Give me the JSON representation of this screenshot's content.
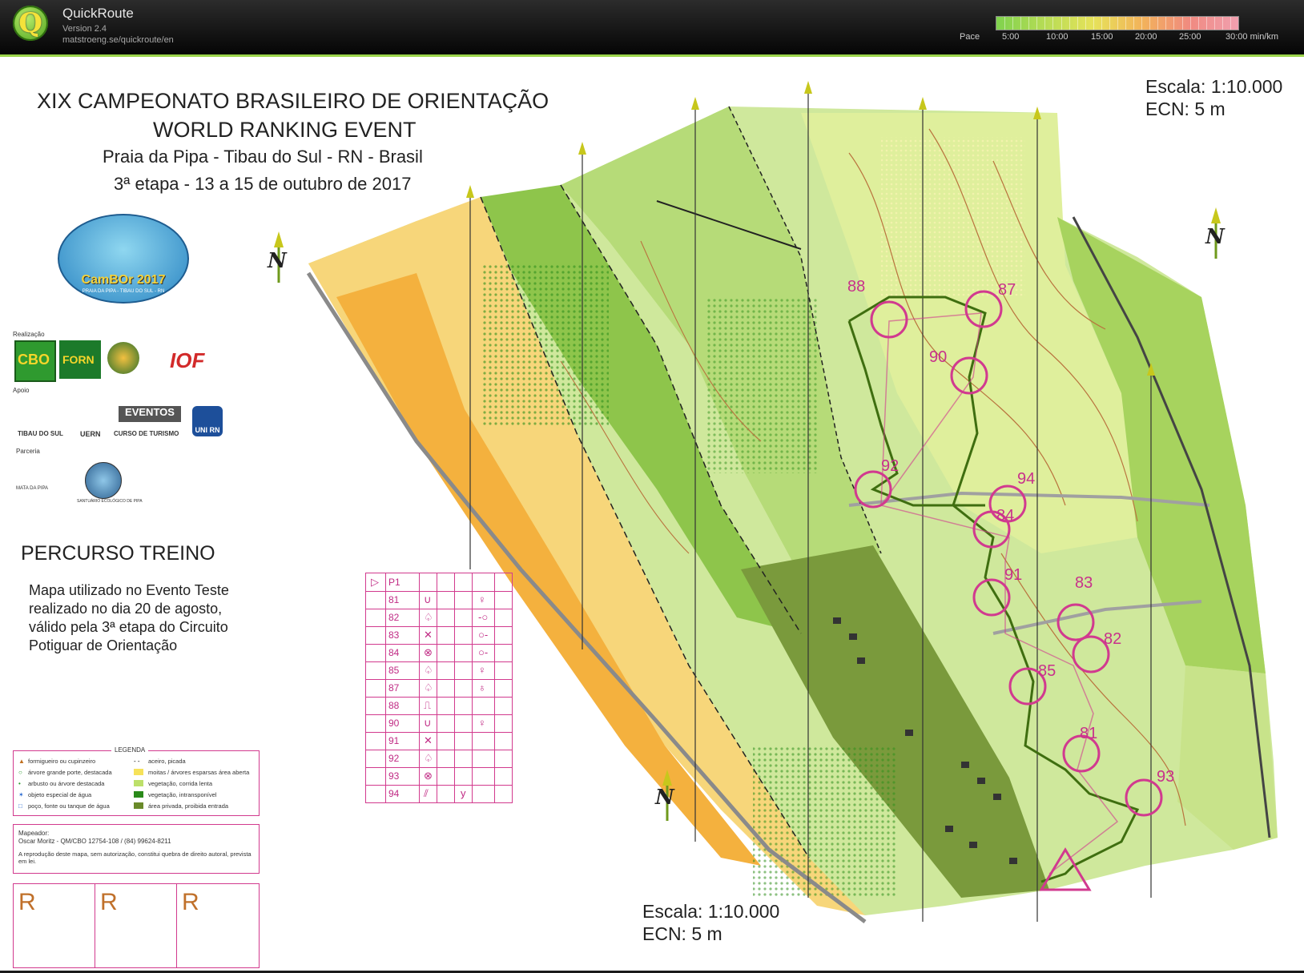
{
  "app": {
    "name": "QuickRoute",
    "version": "Version 2.4",
    "url": "matstroeng.se/quickroute/en",
    "logo_letter": "Q",
    "logo_icon": "quickroute-logo-icon"
  },
  "pace_legend": {
    "label": "Pace",
    "ticks": [
      "5:00",
      "10:00",
      "15:00",
      "20:00",
      "25:00",
      "30:00 min/km"
    ],
    "colors": [
      "#7fd24e",
      "#b6dc55",
      "#e6e25a",
      "#f2b35a",
      "#f08a80",
      "#f0a0b0"
    ]
  },
  "map": {
    "title_lines": [
      "XIX CAMPEONATO BRASILEIRO DE ORIENTAÇÃO",
      "WORLD RANKING EVENT",
      "Praia da Pipa - Tibau do Sul - RN - Brasil",
      "3ª etapa - 13 a 15 de outubro de 2017"
    ],
    "scale_top_right": [
      "Escala: 1:10.000",
      "ECN: 5 m"
    ],
    "scale_bottom": [
      "Escala: 1:10.000",
      "ECN: 5 m"
    ],
    "north_letter": "N",
    "event_logo": {
      "name": "cambor-2017-logo",
      "text": "CamBOr 2017",
      "subtitle": "PRAIA DA PIPA - TIBAU DO SUL - RN"
    },
    "sections": {
      "realizacao": "Realização",
      "apoio": "Apoio",
      "parceria": "Parceria"
    },
    "sponsors": {
      "realizacao": [
        "CBO",
        "FORN",
        "IOF"
      ],
      "apoio": [
        "TIBAU DO SUL",
        "UERN",
        "EVENTOS",
        "CURSO DE TURISMO",
        "UNI RN"
      ],
      "parceria": [
        "MATA DA PIPA",
        "SANTUÁRIO ECOLÓGICO DE PIPA"
      ]
    },
    "course_title": "PERCURSO TREINO",
    "note": "Mapa utilizado no Evento Teste realizado no dia 20 de agosto, válido pela 3ª etapa do Circuito Potiguar de Orientação",
    "legend": {
      "title": "LEGENDA",
      "items_left": [
        "formigueiro ou cupinzeiro",
        "árvore grande porte, destacada",
        "arbusto ou árvore destacada",
        "objeto especial de água",
        "poço, fonte ou tanque de água"
      ],
      "items_right": [
        "aceiro, picada",
        "moitas / árvores esparsas área aberta",
        "vegetação, corrida lenta",
        "vegetação, intransponível",
        "área privada, proibida entrada"
      ]
    },
    "mapper": {
      "label": "Mapeador:",
      "name": "Oscar Moritz - QM/CBO 12754-108 / (84) 99624-8211",
      "copyright": "A reprodução deste mapa, sem autorização, constitui quebra de direito autoral, prevista  em lei."
    },
    "r_labels": [
      "R",
      "R",
      "R"
    ],
    "control_table": {
      "start": "P1",
      "rows": [
        {
          "code": "81",
          "symbol": "∪",
          "extra": "♀"
        },
        {
          "code": "82",
          "symbol": "♤",
          "extra": "-○"
        },
        {
          "code": "83",
          "symbol": "✕",
          "extra": "○-"
        },
        {
          "code": "84",
          "symbol": "⊗",
          "extra": "○-"
        },
        {
          "code": "85",
          "symbol": "♤",
          "extra": "♀"
        },
        {
          "code": "87",
          "symbol": "♤",
          "extra": "♁"
        },
        {
          "code": "88",
          "symbol": "⎍",
          "extra": ""
        },
        {
          "code": "90",
          "symbol": "∪",
          "extra": "♀"
        },
        {
          "code": "91",
          "symbol": "✕",
          "extra": ""
        },
        {
          "code": "92",
          "symbol": "♤",
          "extra": ""
        },
        {
          "code": "93",
          "symbol": "⊗",
          "extra": ""
        },
        {
          "code": "94",
          "symbol": "⫽",
          "extra": "y"
        }
      ]
    },
    "controls": [
      {
        "num": "88"
      },
      {
        "num": "87"
      },
      {
        "num": "90"
      },
      {
        "num": "92"
      },
      {
        "num": "94"
      },
      {
        "num": "84"
      },
      {
        "num": "91"
      },
      {
        "num": "83"
      },
      {
        "num": "82"
      },
      {
        "num": "85"
      },
      {
        "num": "81"
      },
      {
        "num": "93"
      }
    ]
  }
}
